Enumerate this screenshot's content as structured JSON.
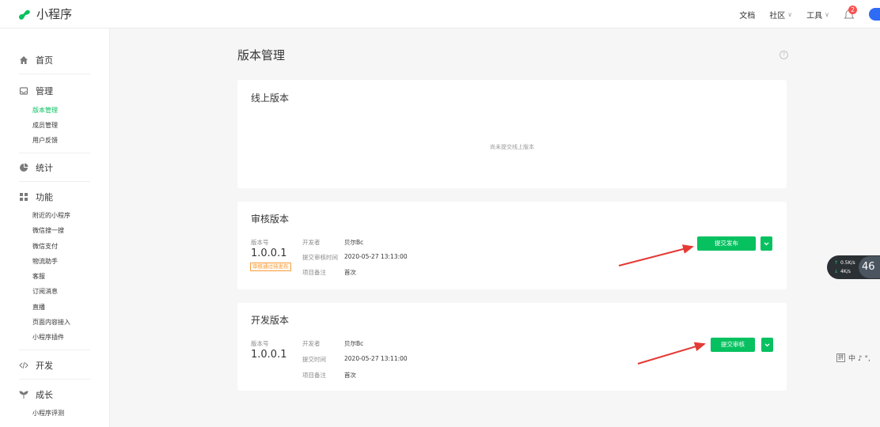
{
  "app": {
    "title": "小程序"
  },
  "topnav": {
    "docs": "文档",
    "community": "社区",
    "tools": "工具",
    "notification_count": "2"
  },
  "sidebar": {
    "home": "首页",
    "manage": "管理",
    "manage_items": [
      "版本管理",
      "成员管理",
      "用户反馈"
    ],
    "stats": "统计",
    "features": "功能",
    "feature_items": [
      "附近的小程序",
      "微信搜一搜",
      "微信支付",
      "物流助手",
      "客服",
      "订阅消息",
      "直播",
      "页面内容接入",
      "小程序插件"
    ],
    "dev": "开发",
    "growth": "成长",
    "growth_items": [
      "小程序评测"
    ]
  },
  "main": {
    "title": "版本管理",
    "help": "?"
  },
  "online": {
    "title": "线上版本",
    "empty": "尚未提交线上版本"
  },
  "review": {
    "title": "审核版本",
    "version_label": "版本号",
    "version": "1.0.0.1",
    "status_tag": "审核通过待发布",
    "developer_label": "开发者",
    "developer": "贝尔Bc",
    "submit_time_label": "提交审核时间",
    "submit_time": "2020-05-27 13:13:00",
    "remark_label": "项目备注",
    "remark": "首次",
    "action_button": "提交发布"
  },
  "development": {
    "title": "开发版本",
    "version_label": "版本号",
    "version": "1.0.0.1",
    "developer_label": "开发者",
    "developer": "贝尔Bc",
    "submit_time_label": "提交时间",
    "submit_time": "2020-05-27 13:11:00",
    "remark_label": "项目备注",
    "remark": "首次",
    "action_button": "提交审核"
  },
  "speed_widget": {
    "upload": "0.5K/s",
    "download": "4K/s",
    "percent": "46"
  },
  "ime": {
    "label": "拼",
    "chars": "中 ♪ °,"
  },
  "colors": {
    "accent": "#07c160",
    "warning": "#fa9d3b",
    "badge": "#fa5151",
    "arrow": "#e53935"
  }
}
